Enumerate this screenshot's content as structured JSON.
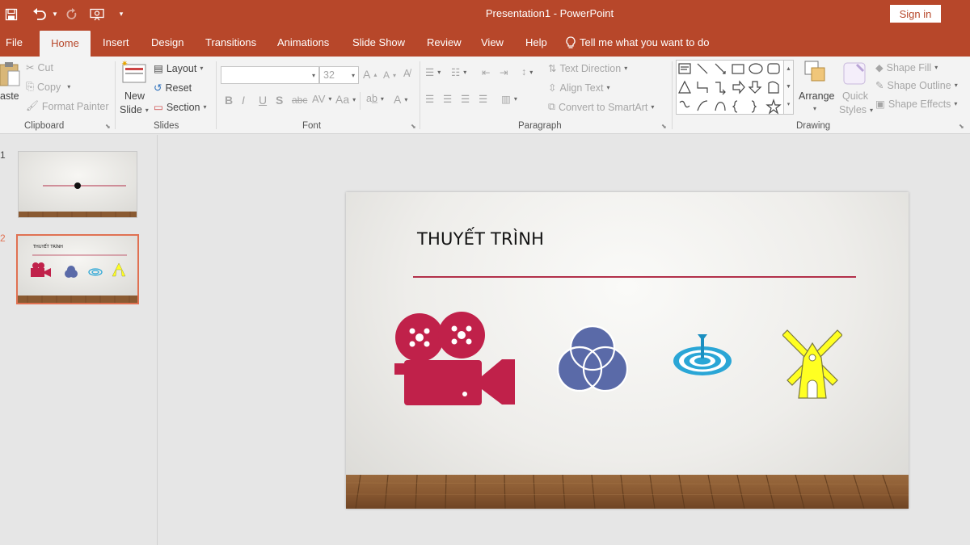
{
  "app": {
    "title": "Presentation1  -  PowerPoint",
    "signin_label": "Sign in",
    "brand_color": "#b7472a"
  },
  "tabs": [
    "File",
    "Home",
    "Insert",
    "Design",
    "Transitions",
    "Animations",
    "Slide Show",
    "Review",
    "View",
    "Help"
  ],
  "active_tab": "Home",
  "tell_me": "Tell me what you want to do",
  "ribbon": {
    "clipboard": {
      "paste": "aste",
      "cut": "Cut",
      "copy": "Copy",
      "format_painter": "Format Painter",
      "label": "Clipboard"
    },
    "slides": {
      "new_slide_1": "New",
      "new_slide_2": "Slide",
      "layout": "Layout",
      "reset": "Reset",
      "section": "Section",
      "label": "Slides"
    },
    "font": {
      "font_name": "",
      "font_size": "32",
      "label": "Font"
    },
    "paragraph": {
      "text_direction": "Text Direction",
      "align_text": "Align Text",
      "convert_smartart": "Convert to SmartArt",
      "label": "Paragraph"
    },
    "drawing": {
      "arrange": "Arrange",
      "quick_styles_1": "Quick",
      "quick_styles_2": "Styles",
      "shape_fill": "Shape Fill",
      "shape_outline": "Shape Outline",
      "shape_effects": "Shape Effects",
      "label": "Drawing"
    }
  },
  "thumbnails": [
    {
      "number": "1",
      "selected": false
    },
    {
      "number": "2",
      "selected": true,
      "title": "THUYẾT TRÌNH"
    }
  ],
  "slide": {
    "title": "THUYẾT TRÌNH",
    "line_color": "#b2304a",
    "icons": [
      "movie-camera-icon",
      "venn-diagram-icon",
      "target-icon",
      "windmill-icon"
    ],
    "icon_colors": [
      "#c0214a",
      "#5a6aa8",
      "#2aa6d6",
      "#ffff22"
    ]
  }
}
